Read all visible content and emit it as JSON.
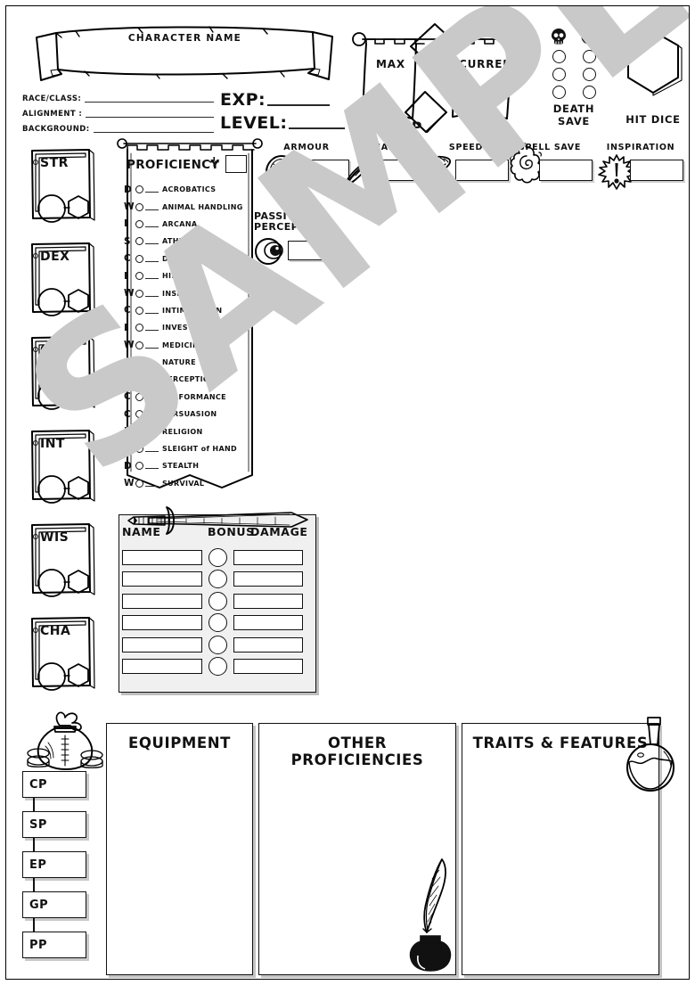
{
  "document": {
    "kind": "dnd-character-sheet",
    "watermark": "SAMPLE"
  },
  "banner": {
    "label": "CHARACTER NAME"
  },
  "identity": {
    "rows": [
      {
        "label": "RACE/CLASS:"
      },
      {
        "label": "ALIGNMENT :"
      },
      {
        "label": "BACKGROUND:"
      }
    ]
  },
  "progress": {
    "rows": [
      {
        "label": "EXP:"
      },
      {
        "label": "LEVEL:"
      }
    ]
  },
  "hp": {
    "title": "HP",
    "max_label": "MAX",
    "current_label": "CURRENT",
    "temp_label": "TEMP"
  },
  "death_save": {
    "label": "DEATH SAVE",
    "fail_icon": "skull-icon",
    "success_icon": "smiley-icon",
    "rows": 3,
    "columns": 2
  },
  "hit_dice": {
    "label": "HIT DICE",
    "shape": "hexagon"
  },
  "abilities": {
    "items": [
      {
        "name": "STR"
      },
      {
        "name": "DEX"
      },
      {
        "name": "CON"
      },
      {
        "name": "INT"
      },
      {
        "name": "WIS"
      },
      {
        "name": "CHA"
      }
    ]
  },
  "proficiency": {
    "title": "PROFICIENCY",
    "plus_glyph": "✛",
    "skills": [
      {
        "ability": "D",
        "name": "ACROBATICS"
      },
      {
        "ability": "W",
        "name": "ANIMAL HANDLING"
      },
      {
        "ability": "I",
        "name": "ARCANA"
      },
      {
        "ability": "S",
        "name": "ATHLETICS"
      },
      {
        "ability": "C",
        "name": "DECEPTION"
      },
      {
        "ability": "I",
        "name": "HISTORY"
      },
      {
        "ability": "W",
        "name": "INSIGHT"
      },
      {
        "ability": "C",
        "name": "INTIMIDATION"
      },
      {
        "ability": "I",
        "name": "INVESTIGATION"
      },
      {
        "ability": "W",
        "name": "MEDICINE"
      },
      {
        "ability": "I",
        "name": "NATURE"
      },
      {
        "ability": "W",
        "name": "PERCEPTION"
      },
      {
        "ability": "C",
        "name": "PERFORMANCE"
      },
      {
        "ability": "C",
        "name": "PERSUASION"
      },
      {
        "ability": "I",
        "name": "RELIGION"
      },
      {
        "ability": "D",
        "name": "SLEIGHT of HAND"
      },
      {
        "ability": "D",
        "name": "STEALTH"
      },
      {
        "ability": "W",
        "name": "SURVIVAL"
      }
    ]
  },
  "stats": {
    "armour": {
      "label": "ARMOUR",
      "icon": "shield-icon"
    },
    "initiative": {
      "label": "INITIAITIVE",
      "icon": "wing-icon"
    },
    "speed": {
      "label": "SPEED",
      "icon": "boot-icon"
    },
    "spell_save": {
      "label": "SPELL SAVE",
      "icon": "spell-swirl-icon"
    },
    "inspiration": {
      "label": "INSPIRATION",
      "icon": "exclamation-burst-icon"
    }
  },
  "passive_perception": {
    "line1": "PASSIVE",
    "line2": "PERCEPTION",
    "icon": "eye-icon"
  },
  "weapons": {
    "icon": "sword-icon",
    "headers": {
      "name": "NAME",
      "bonus": "BONUS",
      "damage": "DAMAGE"
    },
    "row_count": 6
  },
  "panels": [
    {
      "id": "equipment",
      "title": "EQUIPMENT"
    },
    {
      "id": "other-proficiencies",
      "title": "OTHER PROFICIENCIES"
    },
    {
      "id": "traits-features",
      "title": "TRAITS & FEATURES"
    }
  ],
  "currency": {
    "icon": "money-bag-icon",
    "items": [
      {
        "label": "CP"
      },
      {
        "label": "SP"
      },
      {
        "label": "EP"
      },
      {
        "label": "GP"
      },
      {
        "label": "PP"
      }
    ]
  },
  "decorations": {
    "ink_pot": "ink-pot-quill-icon",
    "potion": "potion-flask-icon"
  },
  "colors": {
    "ink": "#111111",
    "paper": "#ffffff",
    "watermark": "#c9c9c9",
    "panel_shadow": "#c4c4c4",
    "weapon_card": "#f0f0f0"
  }
}
